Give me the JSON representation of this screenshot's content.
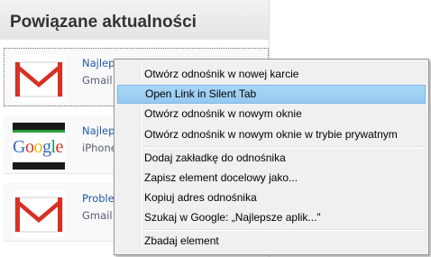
{
  "panel": {
    "title": "Powiązane aktualności",
    "items": [
      {
        "line1": "Najlepsze aplikacje do obsługi",
        "line2": "Gmail",
        "thumb": "gmail-envelope-icon"
      },
      {
        "line1": "Najlepsze...",
        "line2": "iPhone",
        "thumb": "google-logo"
      },
      {
        "line1": "Problem...",
        "line2": "Gmail",
        "thumb": "gmail-envelope-icon"
      }
    ]
  },
  "context_menu": {
    "items": [
      {
        "label": "Otwórz odnośnik w nowej karcie"
      },
      {
        "label": "Open Link in Silent Tab",
        "highlighted": true
      },
      {
        "label": "Otwórz odnośnik w nowym oknie"
      },
      {
        "label": "Otwórz odnośnik w nowym oknie w trybie prywatnym"
      },
      {
        "label": "Dodaj zakładkę do odnośnika"
      },
      {
        "label": "Zapisz element docelowy jako..."
      },
      {
        "label": "Kopiuj adres odnośnika"
      },
      {
        "label": "Szukaj w Google: „Najlepsze aplik...\""
      },
      {
        "label": "Zbadaj element"
      }
    ]
  },
  "colors": {
    "highlight": "#aad6f6",
    "link": "#1f5aa8",
    "gmail_red": "#d93025"
  }
}
